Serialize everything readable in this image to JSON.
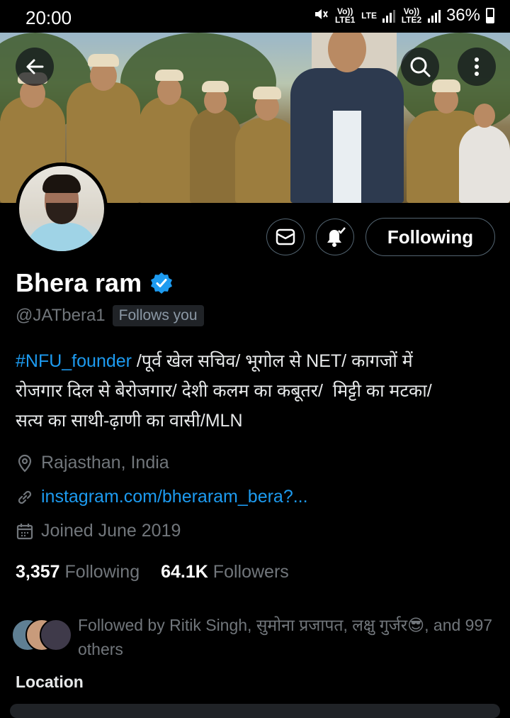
{
  "status_bar": {
    "time": "20:00",
    "sim1": "Vo)) LTE1",
    "lte": "LTE",
    "sim2": "Vo)) LTE2",
    "battery": "36%"
  },
  "header": {
    "back_icon": "arrow-left-icon",
    "search_icon": "search-icon",
    "more_icon": "more-vertical-icon"
  },
  "profile": {
    "name": "Bhera ram",
    "verified": true,
    "handle": "@JATbera1",
    "follows_you": "Follows you",
    "buttons": {
      "message_icon": "envelope-icon",
      "notify_icon": "bell-check-icon",
      "following_label": "Following"
    },
    "bio": {
      "hashtag": "#NFU_founder",
      "line1_rest": " /पूर्व खेल सचिव/ भूगोल से NET/ कागजों में",
      "line2": "रोजगार दिल से बेरोजगार/ देशी कलम का कबूतर/  मिट्टी का मटका/",
      "line3": "सत्य का साथी-ढ़ाणी का वासी/MLN"
    },
    "location": "Rajasthan, India",
    "website": "instagram.com/bheraram_bera?...",
    "joined": "Joined June 2019",
    "following_count": "3,357",
    "following_label": "Following",
    "followers_count": "64.1K",
    "followers_label": "Followers",
    "followed_by": "Followed by Ritik Singh, सुमोना प्रजापत, लक्षु गुर्जर😎, and 997 others",
    "section_heading": "Location"
  },
  "colors": {
    "accent": "#1d9bf0",
    "muted": "#71767b",
    "background": "#000000",
    "text": "#e7e9ea"
  }
}
